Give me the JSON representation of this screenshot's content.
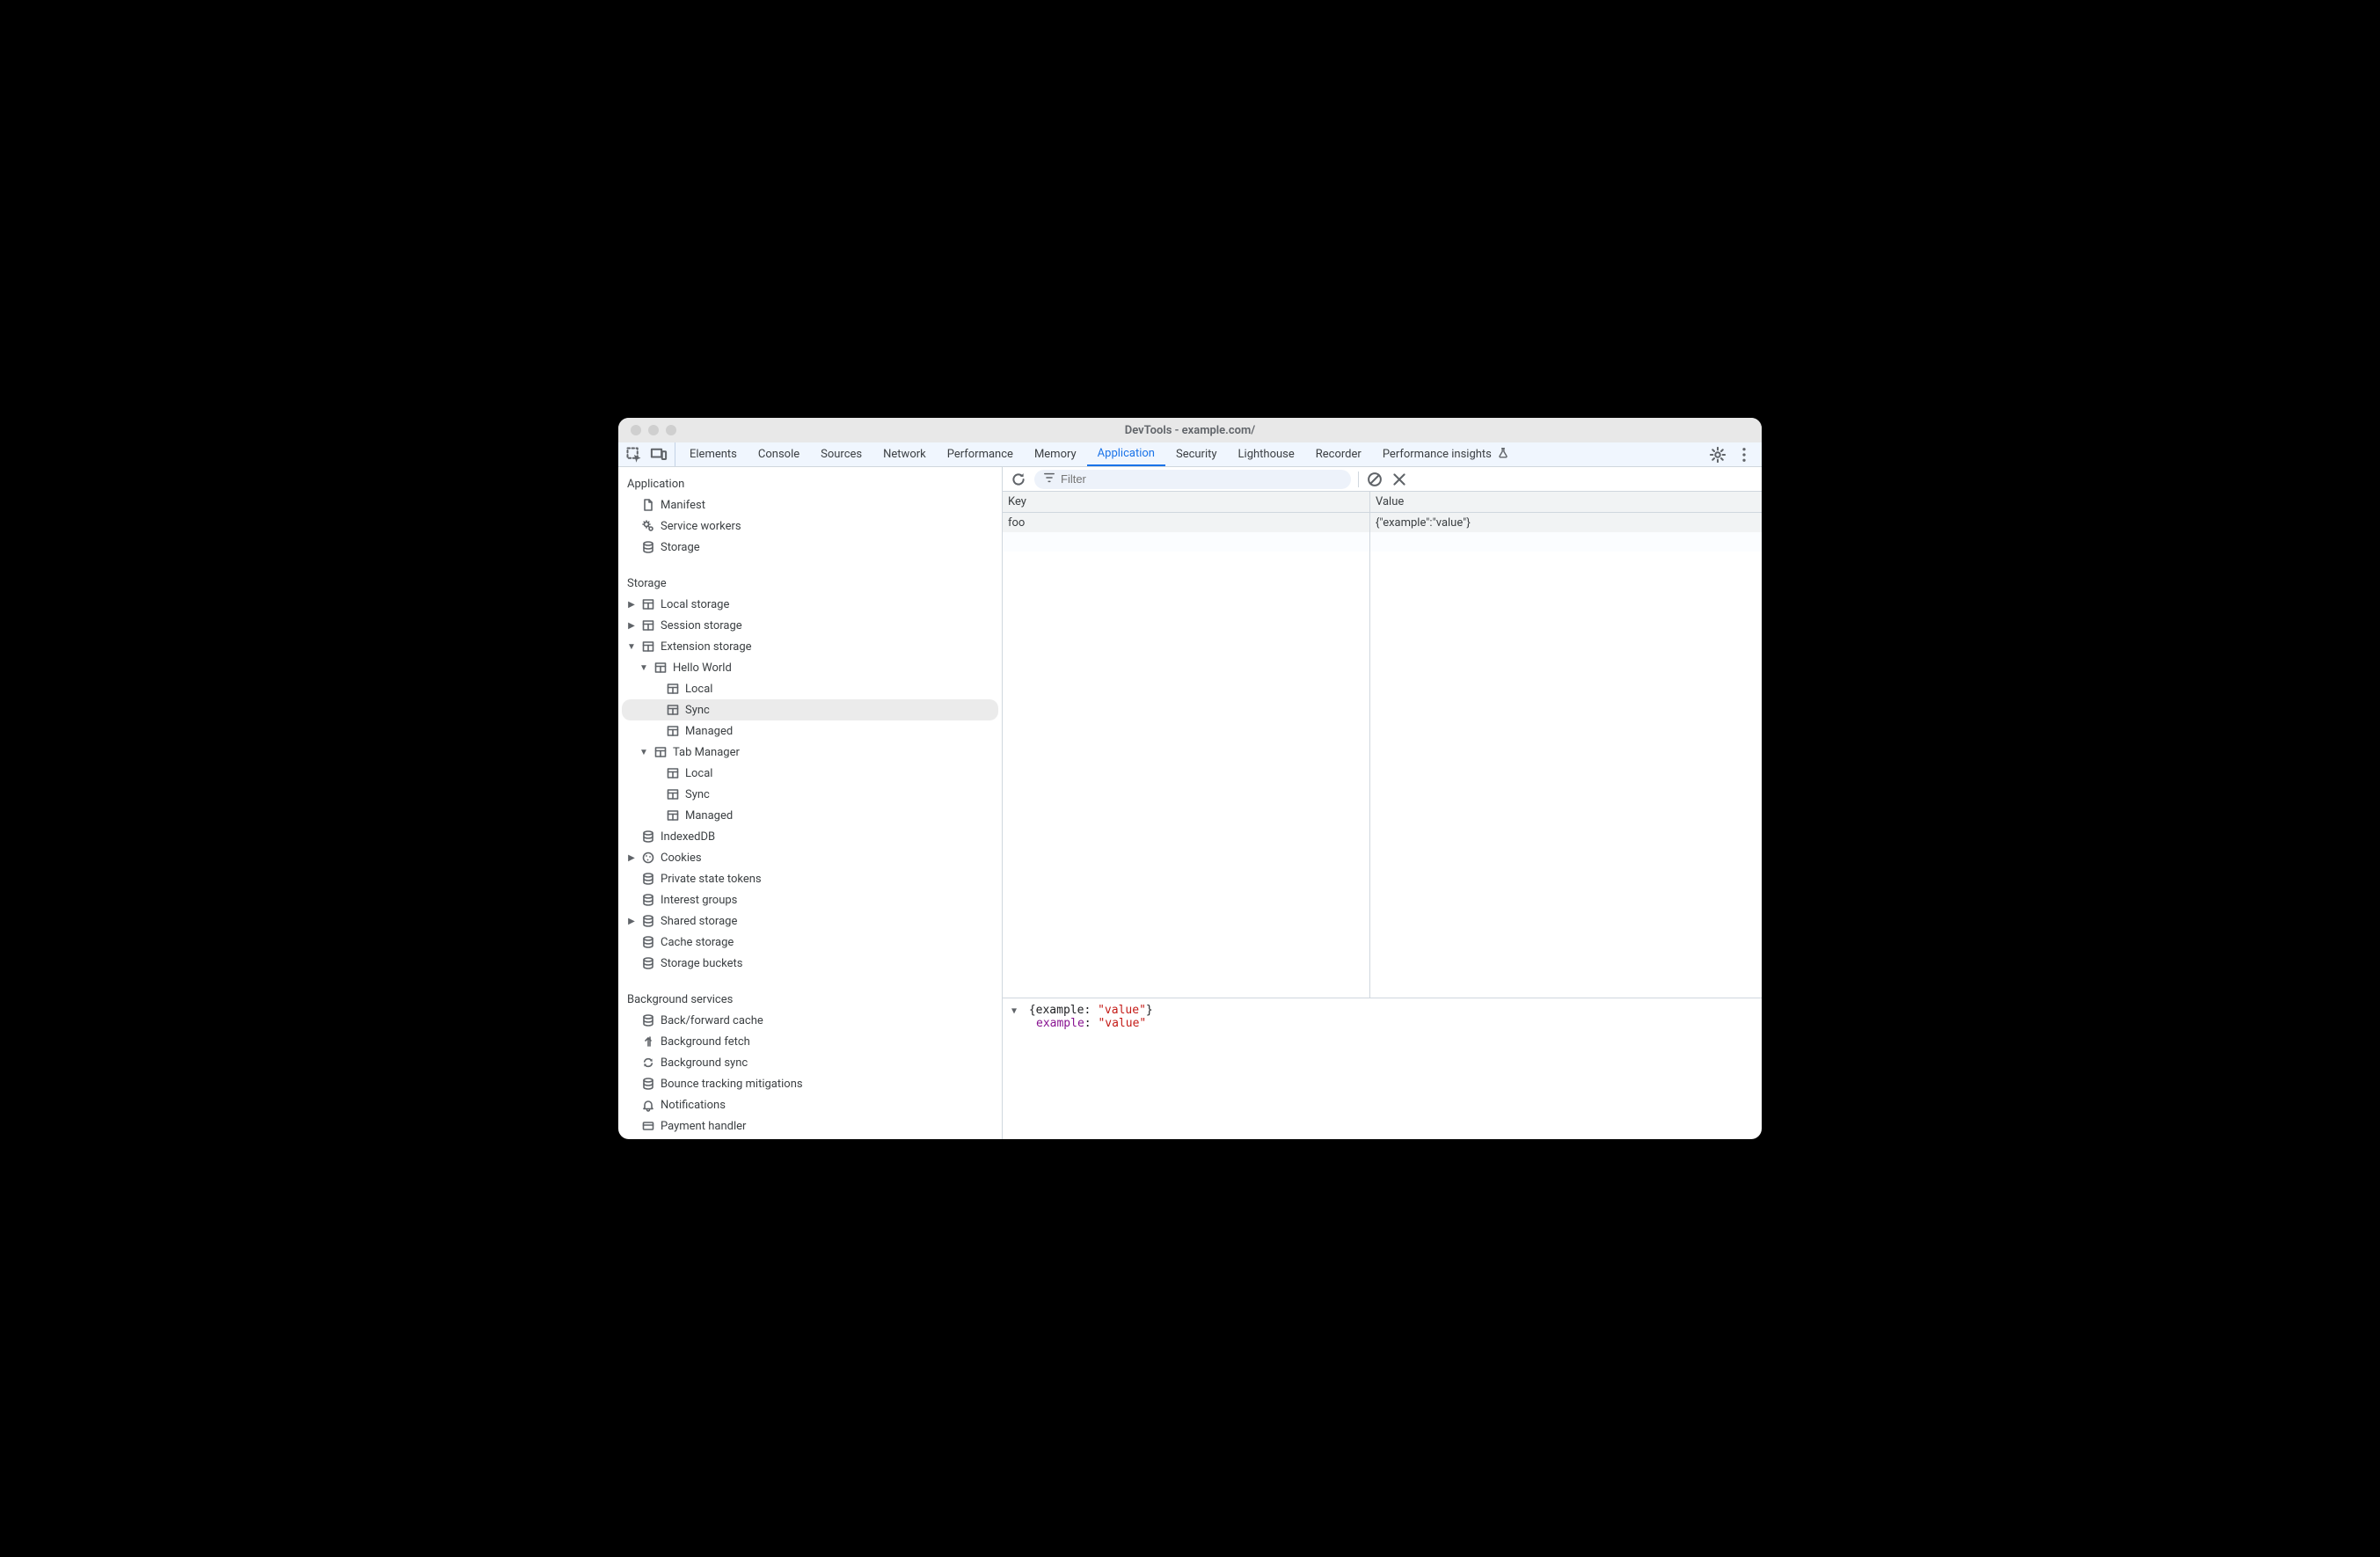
{
  "window": {
    "title": "DevTools - example.com/"
  },
  "tabs": [
    {
      "label": "Elements",
      "active": false
    },
    {
      "label": "Console",
      "active": false
    },
    {
      "label": "Sources",
      "active": false
    },
    {
      "label": "Network",
      "active": false
    },
    {
      "label": "Performance",
      "active": false
    },
    {
      "label": "Memory",
      "active": false
    },
    {
      "label": "Application",
      "active": true
    },
    {
      "label": "Security",
      "active": false
    },
    {
      "label": "Lighthouse",
      "active": false
    },
    {
      "label": "Recorder",
      "active": false
    },
    {
      "label": "Performance insights",
      "active": false,
      "flask": true
    }
  ],
  "sidebar": {
    "sections": [
      {
        "title": "Application",
        "items": [
          {
            "label": "Manifest",
            "icon": "file",
            "depth": 1
          },
          {
            "label": "Service workers",
            "icon": "gears",
            "depth": 1
          },
          {
            "label": "Storage",
            "icon": "db",
            "depth": 1
          }
        ]
      },
      {
        "title": "Storage",
        "items": [
          {
            "label": "Local storage",
            "icon": "table",
            "depth": 1,
            "arrow": "right"
          },
          {
            "label": "Session storage",
            "icon": "table",
            "depth": 1,
            "arrow": "right"
          },
          {
            "label": "Extension storage",
            "icon": "table",
            "depth": 1,
            "arrow": "down"
          },
          {
            "label": "Hello World",
            "icon": "table",
            "depth": 2,
            "arrow": "down"
          },
          {
            "label": "Local",
            "icon": "table",
            "depth": 3
          },
          {
            "label": "Sync",
            "icon": "table",
            "depth": 3,
            "selected": true
          },
          {
            "label": "Managed",
            "icon": "table",
            "depth": 3
          },
          {
            "label": "Tab Manager",
            "icon": "table",
            "depth": 2,
            "arrow": "down"
          },
          {
            "label": "Local",
            "icon": "table",
            "depth": 3
          },
          {
            "label": "Sync",
            "icon": "table",
            "depth": 3
          },
          {
            "label": "Managed",
            "icon": "table",
            "depth": 3
          },
          {
            "label": "IndexedDB",
            "icon": "db",
            "depth": 1
          },
          {
            "label": "Cookies",
            "icon": "cookie",
            "depth": 1,
            "arrow": "right"
          },
          {
            "label": "Private state tokens",
            "icon": "db",
            "depth": 1
          },
          {
            "label": "Interest groups",
            "icon": "db",
            "depth": 1
          },
          {
            "label": "Shared storage",
            "icon": "db",
            "depth": 1,
            "arrow": "right"
          },
          {
            "label": "Cache storage",
            "icon": "db",
            "depth": 1
          },
          {
            "label": "Storage buckets",
            "icon": "db",
            "depth": 1
          }
        ]
      },
      {
        "title": "Background services",
        "items": [
          {
            "label": "Back/forward cache",
            "icon": "db",
            "depth": 1
          },
          {
            "label": "Background fetch",
            "icon": "fetch",
            "depth": 1
          },
          {
            "label": "Background sync",
            "icon": "sync",
            "depth": 1
          },
          {
            "label": "Bounce tracking mitigations",
            "icon": "db",
            "depth": 1
          },
          {
            "label": "Notifications",
            "icon": "bell",
            "depth": 1
          },
          {
            "label": "Payment handler",
            "icon": "payment",
            "depth": 1
          }
        ]
      }
    ]
  },
  "filter": {
    "placeholder": "Filter"
  },
  "table": {
    "headers": {
      "key": "Key",
      "value": "Value"
    },
    "rows": [
      {
        "key": "foo",
        "value": "{\"example\":\"value\"}"
      }
    ]
  },
  "detail": {
    "summary_prefix": "{example: ",
    "summary_value": "\"value\"",
    "summary_suffix": "}",
    "prop_key": "example",
    "prop_sep": ": ",
    "prop_value": "\"value\""
  }
}
